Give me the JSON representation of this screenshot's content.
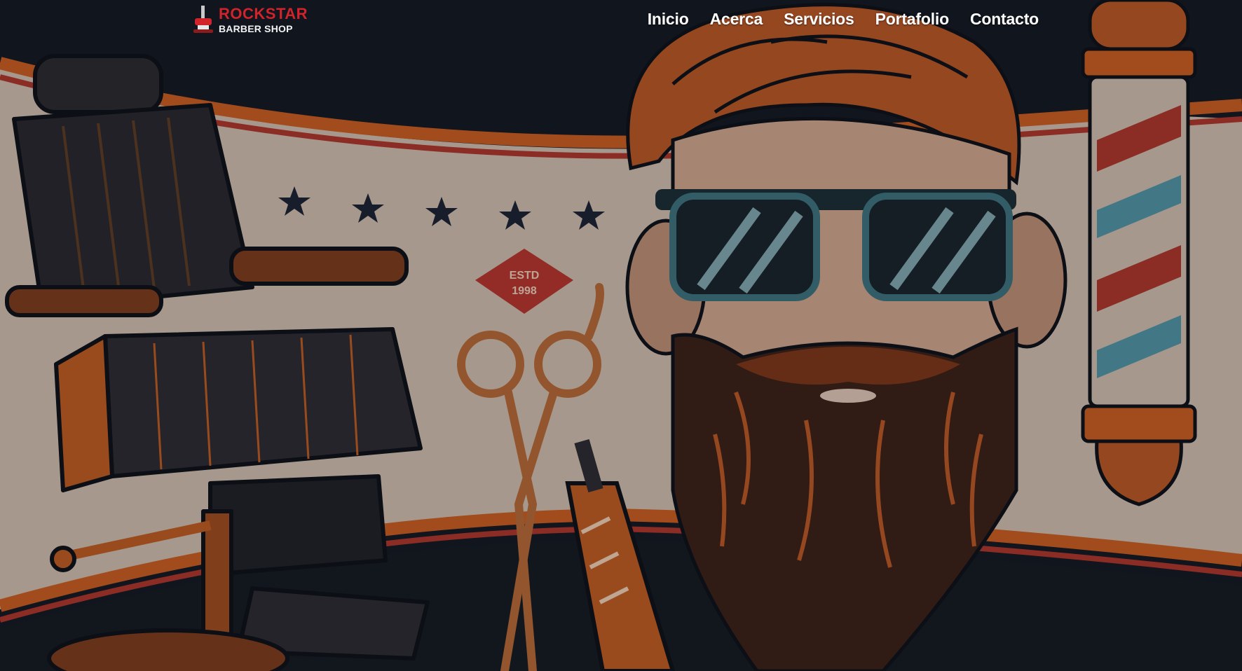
{
  "brand": {
    "name": "ROCKSTAR",
    "tagline": "BARBER SHOP",
    "colors": {
      "accent": "#d0232a",
      "text": "#f2f2f2"
    }
  },
  "nav": {
    "items": [
      {
        "label": "Inicio"
      },
      {
        "label": "Acerca"
      },
      {
        "label": "Servicios"
      },
      {
        "label": "Portafolio"
      },
      {
        "label": "Contacto"
      }
    ]
  },
  "hero": {
    "badge_line1": "ESTD",
    "badge_line2": "1998",
    "stars": 5,
    "colors": {
      "background": "#121821",
      "wall": "#c9b8a8",
      "orange": "#c4591f",
      "red": "#a8342a",
      "blue": "#4f8fa0"
    }
  },
  "icons": [
    "barber-chair-icon",
    "scissors-icon",
    "razor-icon",
    "barber-pole-icon",
    "star-icon"
  ]
}
